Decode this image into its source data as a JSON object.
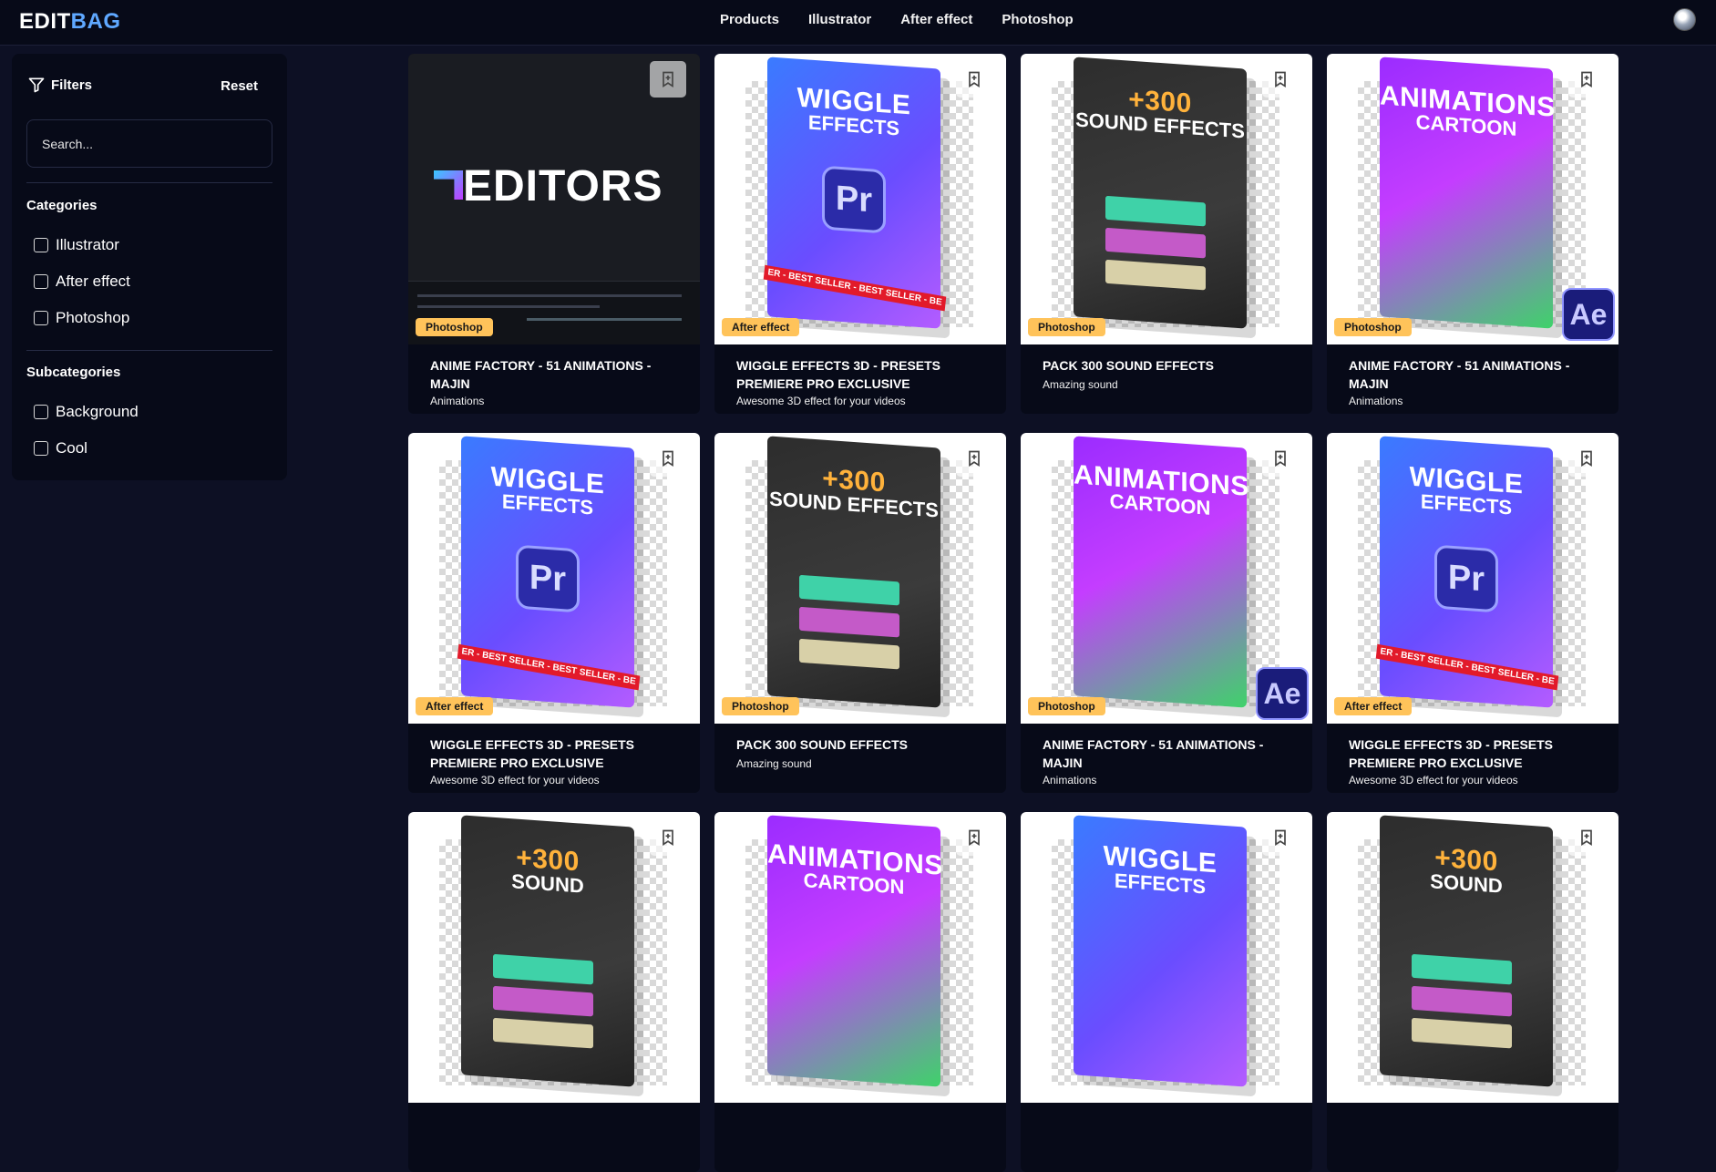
{
  "header": {
    "logo_part1": "EDIT",
    "logo_part2": "BAG",
    "nav": [
      "Products",
      "Illustrator",
      "After effect",
      "Photoshop"
    ]
  },
  "sidebar": {
    "filters_label": "Filters",
    "reset_label": "Reset",
    "search_placeholder": "Search...",
    "categories_title": "Categories",
    "categories": [
      "Illustrator",
      "After effect",
      "Photoshop"
    ],
    "subcategories_title": "Subcategories",
    "subcategories": [
      "Background",
      "Cool"
    ]
  },
  "products": [
    {
      "title": "ANIME FACTORY - 51 ANIMATIONS - MAJIN",
      "subtitle": "Animations",
      "tag": "Photoshop",
      "art": "editors",
      "art_text": "EDITORS"
    },
    {
      "title": "WIGGLE EFFECTS 3D - PRESETS PREMIERE PRO EXCLUSIVE",
      "subtitle": "Awesome 3D effect for your videos",
      "tag": "After effect",
      "art": "wiggle",
      "art_text": "WIGGLE",
      "art_sub": "EFFECTS",
      "art_badge": "Pr",
      "art_ribbon": "ER - BEST SELLER - BEST SELLER - BE"
    },
    {
      "title": "PACK 300 SOUND EFFECTS",
      "subtitle": "Amazing sound",
      "tag": "Photoshop",
      "art": "sound",
      "art_text": "+300",
      "art_sub": "SOUND EFFECTS"
    },
    {
      "title": "ANIME FACTORY - 51 ANIMATIONS - MAJIN",
      "subtitle": "Animations",
      "tag": "Photoshop",
      "art": "cartoon",
      "art_text": "ANIMATIONS",
      "art_sub": "CARTOON",
      "art_badge": "Ae"
    },
    {
      "title": "WIGGLE EFFECTS 3D - PRESETS PREMIERE PRO EXCLUSIVE",
      "subtitle": "Awesome 3D effect for your videos",
      "tag": "After effect",
      "art": "wiggle",
      "art_text": "WIGGLE",
      "art_sub": "EFFECTS",
      "art_badge": "Pr",
      "art_ribbon": "ER - BEST SELLER - BEST SELLER - BE"
    },
    {
      "title": "PACK 300 SOUND EFFECTS",
      "subtitle": "Amazing sound",
      "tag": "Photoshop",
      "art": "sound",
      "art_text": "+300",
      "art_sub": "SOUND EFFECTS"
    },
    {
      "title": "ANIME FACTORY - 51 ANIMATIONS - MAJIN",
      "subtitle": "Animations",
      "tag": "Photoshop",
      "art": "cartoon",
      "art_text": "ANIMATIONS",
      "art_sub": "CARTOON",
      "art_badge": "Ae"
    },
    {
      "title": "WIGGLE EFFECTS 3D - PRESETS PREMIERE PRO EXCLUSIVE",
      "subtitle": "Awesome 3D effect for your videos",
      "tag": "After effect",
      "art": "wiggle",
      "art_text": "WIGGLE",
      "art_sub": "EFFECTS",
      "art_badge": "Pr",
      "art_ribbon": "ER - BEST SELLER - BEST SELLER - BE"
    },
    {
      "art": "sound",
      "art_text": "+300",
      "art_sub": "SOUND"
    },
    {
      "art": "cartoon",
      "art_text": "ANIMATIONS",
      "art_sub": "CARTOON"
    },
    {
      "art": "wiggle",
      "art_text": "WIGGLE",
      "art_sub": "EFFECTS"
    },
    {
      "art": "sound",
      "art_text": "+300",
      "art_sub": "SOUND"
    }
  ],
  "colors": {
    "background": "#0d1024",
    "panel": "#070a18",
    "tag": "#ffc35a",
    "logo_accent": "#5fa8ff"
  }
}
